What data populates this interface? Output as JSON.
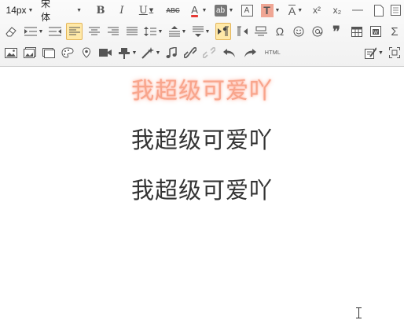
{
  "toolbar": {
    "font_size": "14px",
    "font_family": "宋体",
    "bold_label": "B",
    "italic_label": "I",
    "underline_label": "U",
    "strike_label": "ABC",
    "fore_color_label": "A",
    "bg_color_label": "ab",
    "border_label": "A",
    "shadow_label": "T",
    "spacing_label": "A",
    "sup_label": "x²",
    "sub_label": "x₂",
    "omega_label": "Ω",
    "quote_label": "❞",
    "sigma_label": "Σ",
    "html_label": "HTML",
    "colors": {
      "fore_bar": "#e53935",
      "active_bg": "#ffe9a8",
      "active_border": "#e3b55b",
      "icon": "#555555"
    }
  },
  "editor": {
    "lines": [
      "我超级可爱吖",
      "我超级可爱吖",
      "我超级可爱吖"
    ],
    "glow_color": "#f8a58c"
  }
}
